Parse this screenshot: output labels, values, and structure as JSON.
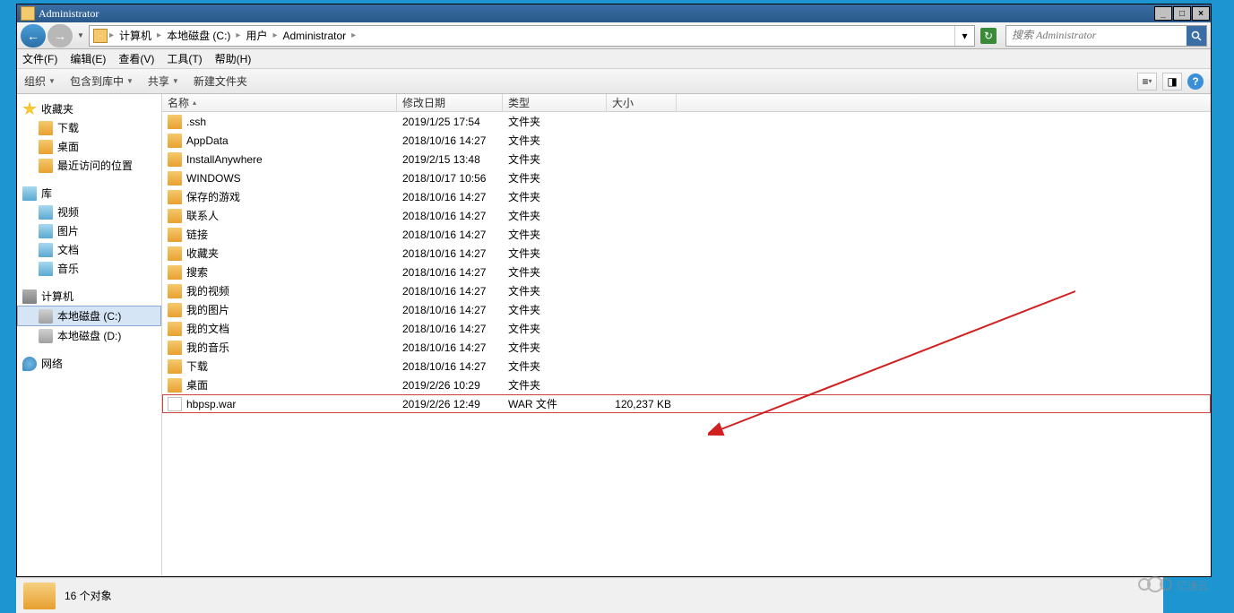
{
  "title": "Administrator",
  "breadcrumb": {
    "root": "计算机",
    "drive": "本地磁盘 (C:)",
    "users": "用户",
    "current": "Administrator"
  },
  "search_placeholder": "搜索 Administrator",
  "menu": {
    "file": "文件(F)",
    "edit": "编辑(E)",
    "view": "查看(V)",
    "tools": "工具(T)",
    "help": "帮助(H)"
  },
  "toolbar": {
    "organize": "组织",
    "include": "包含到库中",
    "share": "共享",
    "newfolder": "新建文件夹"
  },
  "columns": {
    "name": "名称",
    "modified": "修改日期",
    "type": "类型",
    "size": "大小"
  },
  "sidebar": {
    "favorites": "收藏夹",
    "fav_items": [
      "下载",
      "桌面",
      "最近访问的位置"
    ],
    "libraries": "库",
    "lib_items": [
      "视频",
      "图片",
      "文档",
      "音乐"
    ],
    "computer": "计算机",
    "drives": [
      "本地磁盘 (C:)",
      "本地磁盘 (D:)"
    ],
    "network": "网络"
  },
  "files": [
    {
      "name": ".ssh",
      "modified": "2019/1/25 17:54",
      "type": "文件夹",
      "size": "",
      "icon": "folder"
    },
    {
      "name": "AppData",
      "modified": "2018/10/16 14:27",
      "type": "文件夹",
      "size": "",
      "icon": "folder"
    },
    {
      "name": "InstallAnywhere",
      "modified": "2019/2/15 13:48",
      "type": "文件夹",
      "size": "",
      "icon": "folder"
    },
    {
      "name": "WINDOWS",
      "modified": "2018/10/17 10:56",
      "type": "文件夹",
      "size": "",
      "icon": "folder"
    },
    {
      "name": "保存的游戏",
      "modified": "2018/10/16 14:27",
      "type": "文件夹",
      "size": "",
      "icon": "folder"
    },
    {
      "name": "联系人",
      "modified": "2018/10/16 14:27",
      "type": "文件夹",
      "size": "",
      "icon": "folder"
    },
    {
      "name": "链接",
      "modified": "2018/10/16 14:27",
      "type": "文件夹",
      "size": "",
      "icon": "folder"
    },
    {
      "name": "收藏夹",
      "modified": "2018/10/16 14:27",
      "type": "文件夹",
      "size": "",
      "icon": "folder"
    },
    {
      "name": "搜索",
      "modified": "2018/10/16 14:27",
      "type": "文件夹",
      "size": "",
      "icon": "folder"
    },
    {
      "name": "我的视频",
      "modified": "2018/10/16 14:27",
      "type": "文件夹",
      "size": "",
      "icon": "folder"
    },
    {
      "name": "我的图片",
      "modified": "2018/10/16 14:27",
      "type": "文件夹",
      "size": "",
      "icon": "folder"
    },
    {
      "name": "我的文档",
      "modified": "2018/10/16 14:27",
      "type": "文件夹",
      "size": "",
      "icon": "folder"
    },
    {
      "name": "我的音乐",
      "modified": "2018/10/16 14:27",
      "type": "文件夹",
      "size": "",
      "icon": "folder"
    },
    {
      "name": "下载",
      "modified": "2018/10/16 14:27",
      "type": "文件夹",
      "size": "",
      "icon": "folder"
    },
    {
      "name": "桌面",
      "modified": "2019/2/26 10:29",
      "type": "文件夹",
      "size": "",
      "icon": "folder"
    },
    {
      "name": "hbpsp.war",
      "modified": "2019/2/26 12:49",
      "type": "WAR 文件",
      "size": "120,237 KB",
      "icon": "file",
      "highlighted": true
    }
  ],
  "statusbar": "16 个对象",
  "watermark": "亿速云",
  "column_widths": {
    "name": 262,
    "modified": 118,
    "type": 116,
    "size": 78
  }
}
